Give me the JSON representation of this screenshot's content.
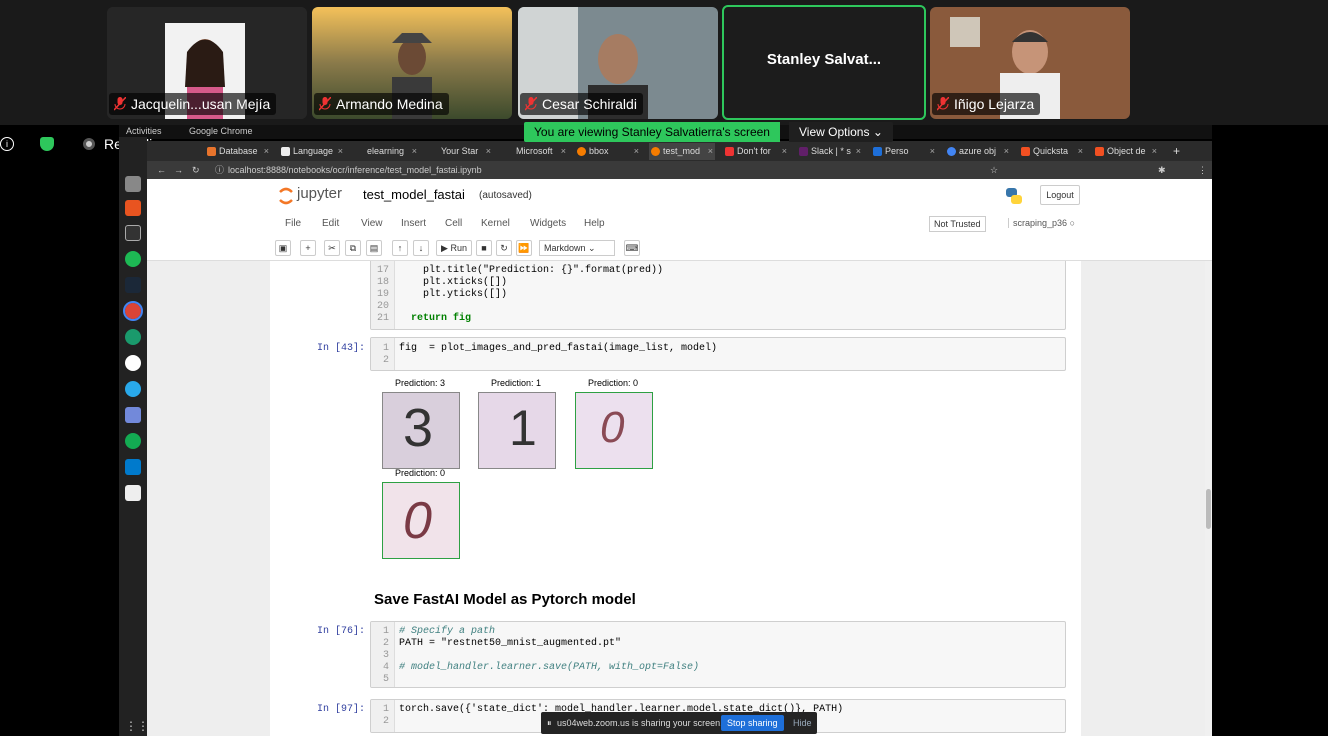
{
  "participants": [
    {
      "name": "Jacquelin...usan Mejía",
      "muted": true
    },
    {
      "name": "Armando Medina",
      "muted": true
    },
    {
      "name": "Cesar Schiraldi",
      "muted": true
    },
    {
      "name": "Stanley Salvat...",
      "muted": false,
      "active": true
    },
    {
      "name": "Iñigo Lejarza",
      "muted": true
    }
  ],
  "share_banner": "You are viewing Stanley Salvatierra's screen",
  "view_options": "View Options",
  "recording": "Recording...",
  "gnome": {
    "activities": "Activities",
    "app": "Google Chrome"
  },
  "tabs": [
    {
      "label": "Database",
      "color": "#e8742c"
    },
    {
      "label": "Language",
      "color": "#f4f4f4"
    },
    {
      "label": "elearning",
      "color": "#444"
    },
    {
      "label": "Your Star",
      "color": "#444"
    },
    {
      "label": "Microsoft",
      "color": "#444"
    },
    {
      "label": "bbox",
      "color": "#f57c00"
    },
    {
      "label": "test_mod",
      "color": "#f57c00"
    },
    {
      "label": "Don't for",
      "color": "#e33"
    },
    {
      "label": "Slack | * s",
      "color": "#611f69"
    },
    {
      "label": "Perso",
      "color": "#1e6fd9"
    },
    {
      "label": "azure obj",
      "color": "#4285f4"
    },
    {
      "label": "Quicksta",
      "color": "#f25022"
    },
    {
      "label": "Object de",
      "color": "#f25022"
    }
  ],
  "url": "localhost:8888/notebooks/ocr/inference/test_model_fastai.ipynb",
  "jupyter": {
    "logo_text": "jupyter",
    "notebook_name": "test_model_fastai",
    "autosaved": "(autosaved)",
    "logout": "Logout",
    "menu": [
      "File",
      "Edit",
      "View",
      "Insert",
      "Cell",
      "Kernel",
      "Widgets",
      "Help"
    ],
    "not_trusted": "Not Trusted",
    "kernel_name": "scraping_p36",
    "run_label": "Run",
    "cell_type": "Markdown"
  },
  "cells": {
    "cell1": {
      "lines": [
        "17",
        "18",
        "19",
        "20",
        "21"
      ],
      "code": [
        "    plt.title(\"Prediction: {}\".format(pred))",
        "    plt.xticks([])",
        "    plt.yticks([])",
        "",
        "  return fig"
      ]
    },
    "cell43": {
      "prompt": "In [43]:",
      "lines": [
        "1",
        "2"
      ],
      "code": [
        "fig  = plot_images_and_pred_fastai(image_list, model)",
        ""
      ]
    },
    "outputs": [
      {
        "caption": "Prediction: 3",
        "digit": "3"
      },
      {
        "caption": "Prediction: 1",
        "digit": "1"
      },
      {
        "caption": "Prediction: 0",
        "digit": "0"
      },
      {
        "caption": "Prediction: 0",
        "digit": "0"
      }
    ],
    "heading": "Save FastAI Model as Pytorch model",
    "cell76": {
      "prompt": "In [76]:",
      "lines": [
        "1",
        "2",
        "3",
        "4",
        "5"
      ],
      "code": [
        "# Specify a path",
        "PATH = \"restnet50_mnist_augmented.pt\"",
        "",
        "# model_handler.learner.save(PATH, with_opt=False)",
        ""
      ]
    },
    "cell97": {
      "prompt": "In [97]:",
      "lines": [
        "1",
        "2"
      ],
      "code": [
        "torch.save({'state_dict': model_handler.learner.model.state_dict()}, PATH)",
        ""
      ]
    }
  },
  "zoom_share_bar": {
    "text": "us04web.zoom.us is sharing your screen.",
    "stop": "Stop sharing",
    "hide": "Hide"
  }
}
